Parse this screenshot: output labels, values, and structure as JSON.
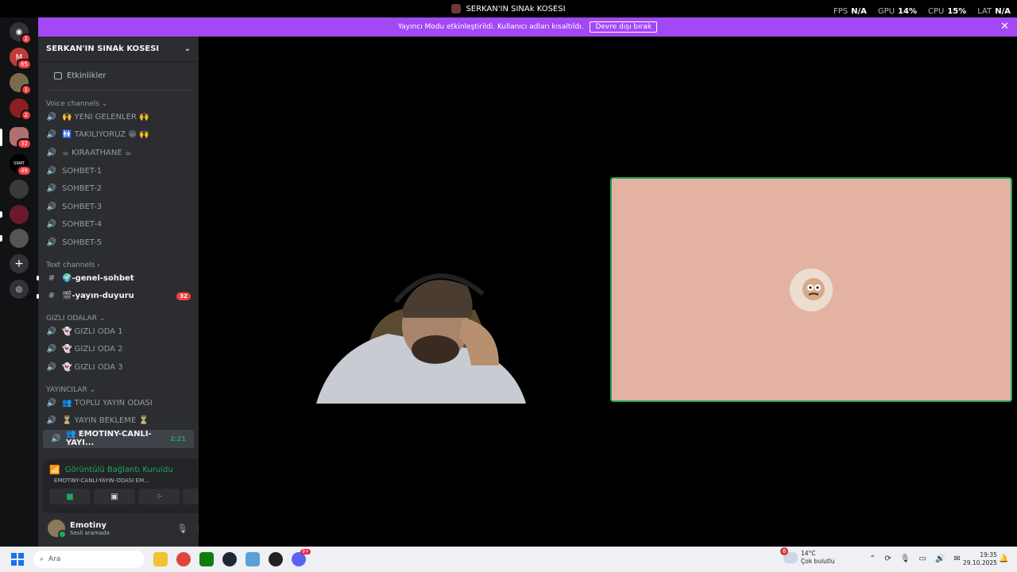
{
  "window": {
    "title": "SERKAN'IN SINAk KOSESI"
  },
  "overlay": {
    "fps_label": "FPS",
    "fps_value": "N/A",
    "gpu_label": "GPU",
    "gpu_value": "14%",
    "cpu_label": "CPU",
    "cpu_value": "15%",
    "lat_label": "LAT",
    "lat_value": "N/A"
  },
  "banner": {
    "text": "Yayıncı Modu etkinleştirildi. Kullanıcı adları kısaltıldı.",
    "button": "Devre dışı bırak"
  },
  "guilds": [
    {
      "badge": "2"
    },
    {
      "badge": "65"
    },
    {
      "badge": "1"
    },
    {
      "badge": "2"
    },
    {
      "badge": "32"
    },
    {
      "badge": "49"
    },
    {
      "badge": ""
    },
    {
      "badge": ""
    },
    {
      "badge": ""
    }
  ],
  "server": {
    "name": "SERKAN'IN SINAk KOSESI",
    "events_label": "Etkinlikler"
  },
  "voice_category": "Voice channels",
  "voice_channels": [
    "🙌 YENI GELENLER 🙌",
    "🚻 TAKILIYORUZ 😁 🙌",
    "☕ KIRAATHANE ☕",
    "SOHBET-1",
    "SOHBET-2",
    "SOHBET-3",
    "SOHBET-4",
    "SOHBET-5"
  ],
  "text_category": "Text channels",
  "text_channels": [
    {
      "name": "🌍-genel-sohbet",
      "badge": ""
    },
    {
      "name": "🎬-yayın-duyuru",
      "badge": "32"
    }
  ],
  "hidden_category": "GIZLI ODALAR",
  "hidden_channels": [
    "👻 GIZLI ODA 1",
    "👻 GIZLI ODA 2",
    "👻 GIZLI ODA 3"
  ],
  "streamers_category": "YAYINCILAR",
  "streamer_channels": [
    "👥 TOPLU YAYIN ODASI",
    "⏳ YAYIN BEKLEME ⏳",
    "👥 EMOTINY-CANLI-YAYI..."
  ],
  "streamer_active_time": "2:21",
  "voice_panel": {
    "status": "Görüntülü Bağlantı Kuruldu",
    "channel": "EMOTINY-CANLI-YAYIN-ODASI EM..."
  },
  "user": {
    "name": "Emotiny",
    "status": "Sesli aramada"
  },
  "taskbar": {
    "search_placeholder": "Ara",
    "weather_badge": "6",
    "temperature": "14°C",
    "condition": "Çok bulutlu",
    "time": "19:35",
    "date": "29.10.2025",
    "app_badge": "9+"
  }
}
